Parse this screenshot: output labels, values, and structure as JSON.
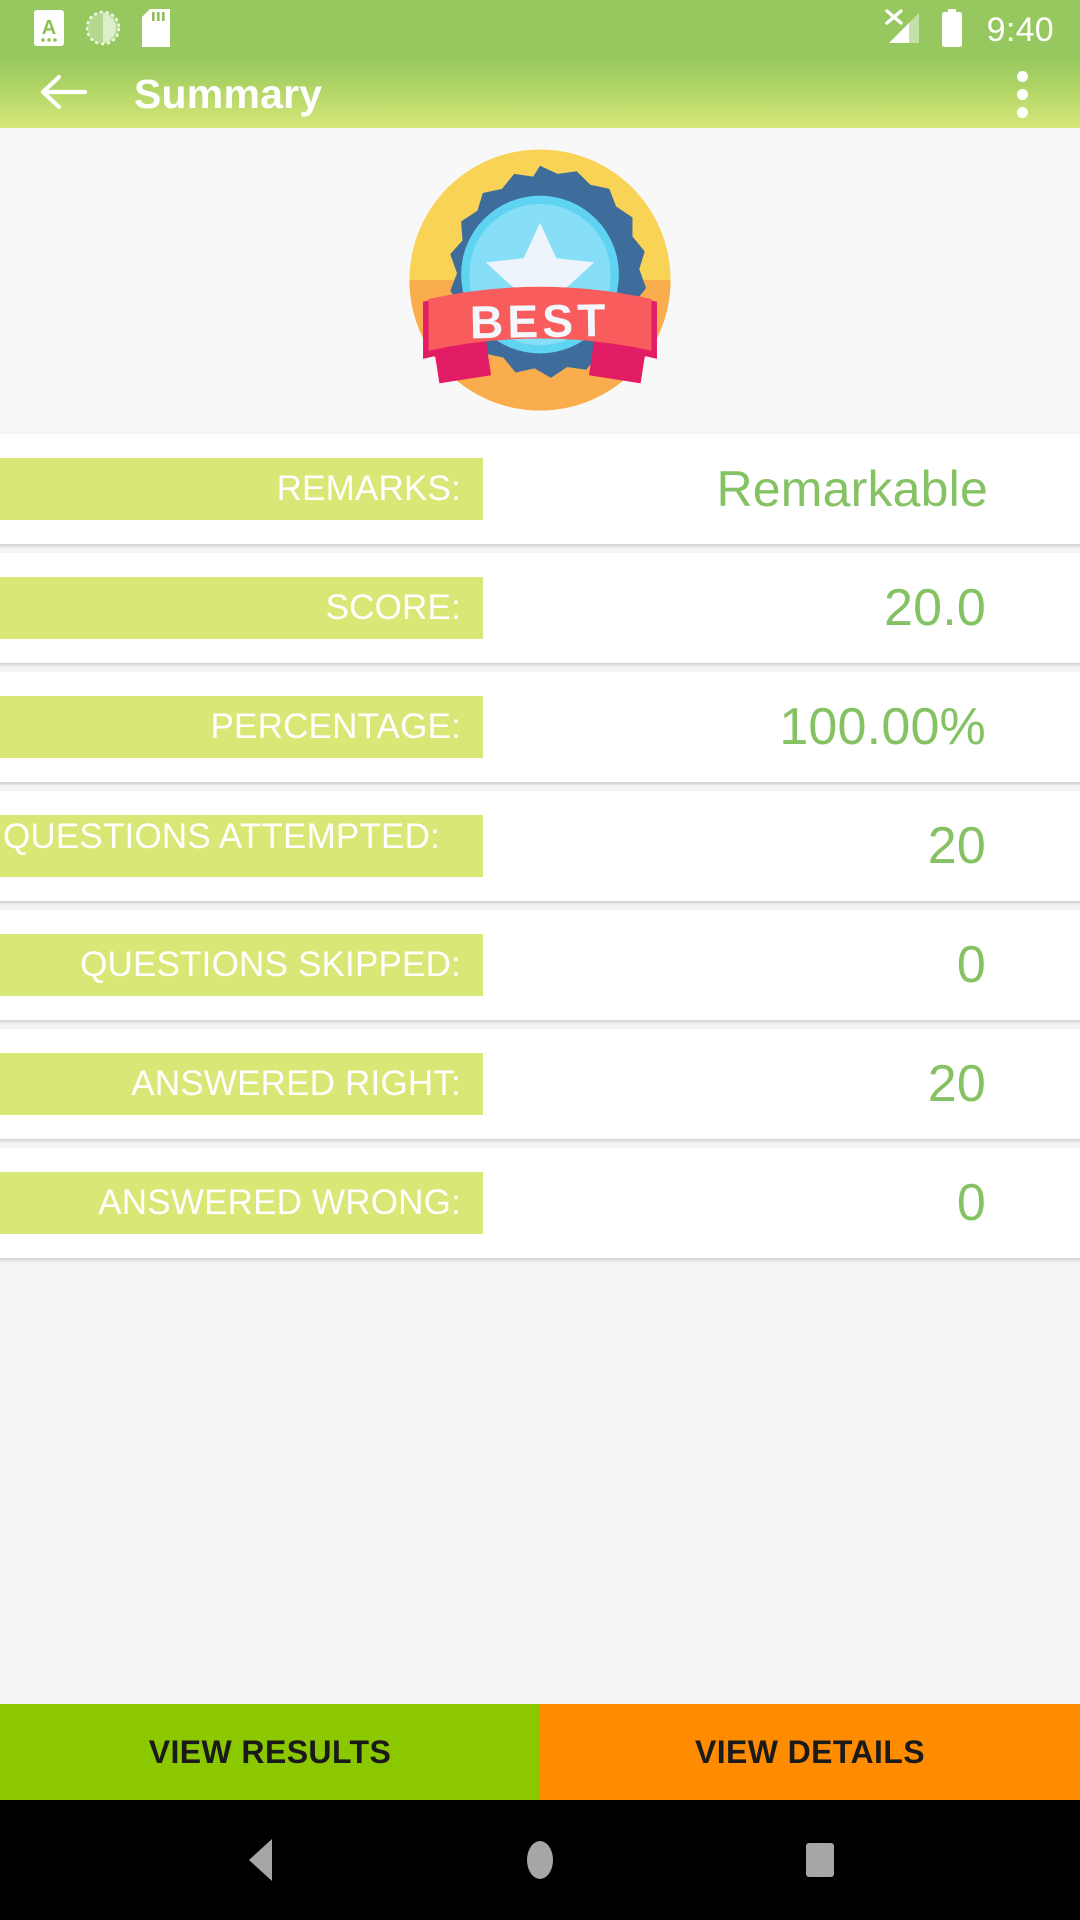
{
  "status_bar": {
    "time": "9:40",
    "icons": [
      {
        "name": "app-notification-icon",
        "glyph": "A"
      },
      {
        "name": "screen-capture-icon",
        "glyph": "dotted-circle"
      },
      {
        "name": "sd-card-icon",
        "glyph": "sd-card"
      }
    ],
    "right_icons": [
      {
        "name": "signal-no-sim-icon"
      },
      {
        "name": "battery-full-icon"
      }
    ],
    "background_color": "#96c85f"
  },
  "app_bar": {
    "title": "Summary",
    "back_icon": "arrow-left-icon",
    "overflow_icon": "more-vertical-icon",
    "gradient_start": "#97c95f",
    "gradient_end": "#d6e77a"
  },
  "badge": {
    "label": "BEST",
    "alt": "best-award-badge",
    "colors": {
      "outer_ring": "#f6d44f",
      "outer_ring_bottom": "#f8a845",
      "star_burst": "#3e6d9c",
      "inner_circle": "#5fd4f2",
      "inner_circle_light": "#86dff7",
      "ribbon": "#f85c5c",
      "ribbon_fold": "#e31c66",
      "star": "#eef4fb"
    }
  },
  "summary": {
    "rows": [
      {
        "label": "REMARKS:",
        "value": "Remarkable",
        "two_line": false
      },
      {
        "label": "SCORE:",
        "value": "20.0",
        "two_line": false
      },
      {
        "label": "PERCENTAGE:",
        "value": "100.00%",
        "two_line": false
      },
      {
        "label": "QUESTIONS ATTEMPTED:",
        "value": "20",
        "two_line": true
      },
      {
        "label": "QUESTIONS SKIPPED:",
        "value": "0",
        "two_line": false
      },
      {
        "label": "ANSWERED RIGHT:",
        "value": "20",
        "two_line": false
      },
      {
        "label": "ANSWERED WRONG:",
        "value": "0",
        "two_line": false
      }
    ],
    "chip_color": "#d9e776",
    "value_color": "#85c263"
  },
  "actions": {
    "view_results": "VIEW RESULTS",
    "view_details": "VIEW DETAILS",
    "results_color": "#8bc800",
    "details_color": "#ff8c00"
  },
  "nav_bar": {
    "back": "nav-back-icon",
    "home": "nav-home-icon",
    "recents": "nav-recents-icon"
  }
}
